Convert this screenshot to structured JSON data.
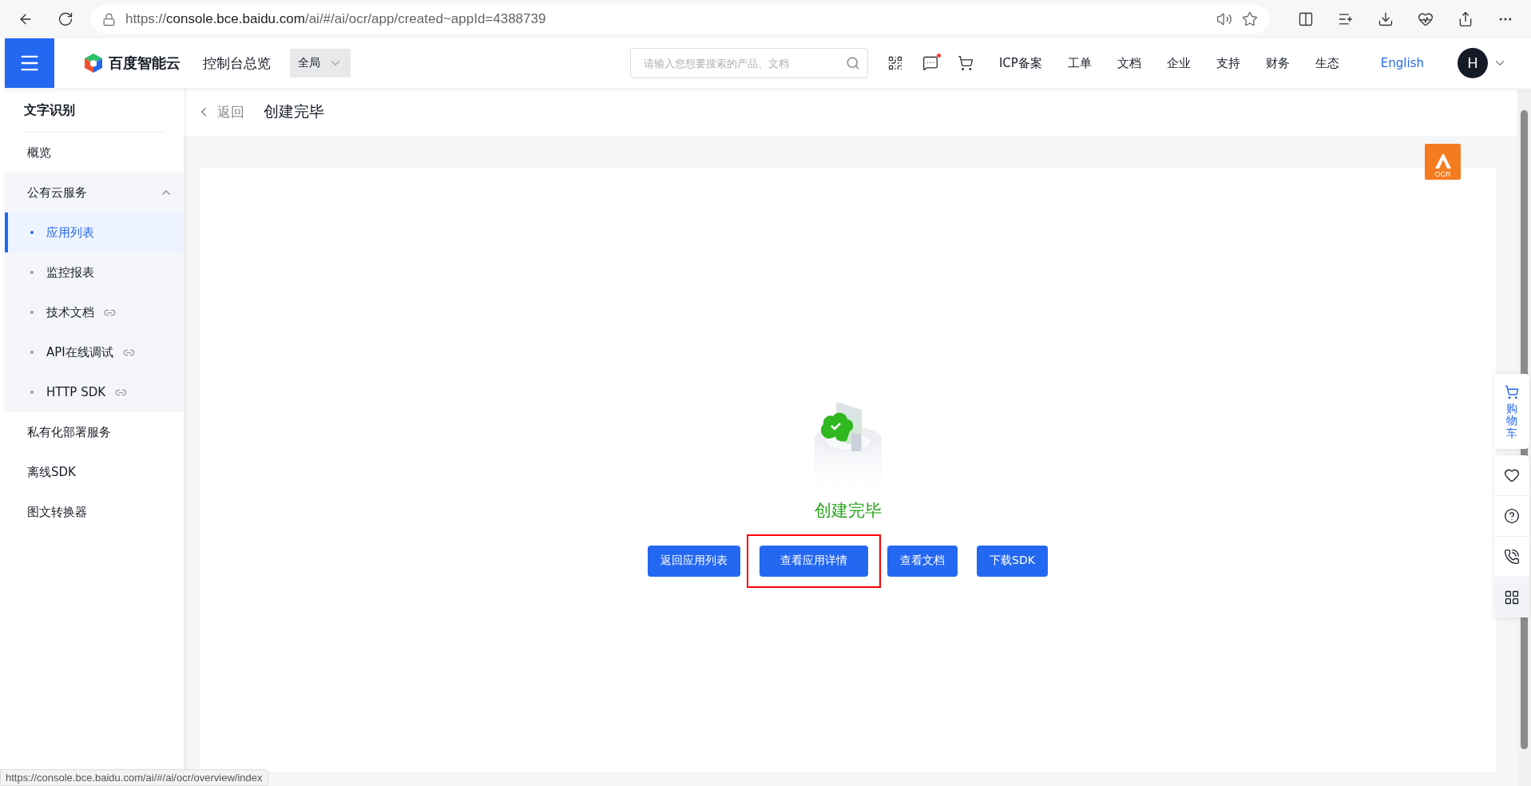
{
  "browser": {
    "url": {
      "scheme": "https://",
      "host": "console.bce.baidu.com",
      "path": "/ai/#/ai/ocr/app/created~appId=4388739"
    }
  },
  "header": {
    "brand": "百度智能云",
    "console_link": "控制台总览",
    "scope": "全局",
    "search": {
      "placeholder": "请输入您想要搜索的产品、文档"
    },
    "message_unread": true,
    "nav": [
      "ICP备案",
      "工单",
      "文档",
      "企业",
      "支持",
      "财务",
      "生态"
    ],
    "language": "English",
    "avatar": "H"
  },
  "sidebar": {
    "title": "文字识别",
    "items": [
      {
        "label": "概览",
        "kind": "item",
        "selected": false
      },
      {
        "label": "公有云服务",
        "kind": "group",
        "expanded": true,
        "children": [
          {
            "label": "应用列表",
            "selected": true,
            "external": false
          },
          {
            "label": "监控报表",
            "selected": false,
            "external": false
          },
          {
            "label": "技术文档",
            "selected": false,
            "external": true
          },
          {
            "label": "API在线调试",
            "selected": false,
            "external": true
          },
          {
            "label": "HTTP SDK",
            "selected": false,
            "external": true
          }
        ]
      },
      {
        "label": "私有化部署服务",
        "kind": "item",
        "selected": false
      },
      {
        "label": "离线SDK",
        "kind": "item",
        "selected": false
      },
      {
        "label": "图文转换器",
        "kind": "item",
        "selected": false
      }
    ]
  },
  "page": {
    "back": "返回",
    "title": "创建完毕"
  },
  "result": {
    "title": "创建完毕",
    "buttons": [
      {
        "label": "返回应用列表",
        "highlighted": false
      },
      {
        "label": "查看应用详情",
        "highlighted": true
      },
      {
        "label": "查看文档",
        "highlighted": false
      },
      {
        "label": "下载SDK",
        "highlighted": false
      }
    ]
  },
  "ocr_badge": {
    "label": "OCR"
  },
  "float_panel": {
    "cart": "购物车"
  },
  "status_url": "https://console.bce.baidu.com/ai/#/ai/ocr/overview/index"
}
